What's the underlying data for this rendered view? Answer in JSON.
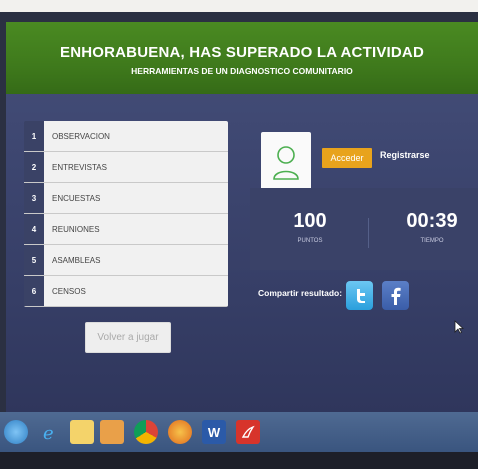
{
  "header": {
    "title": "ENHORABUENA, HAS SUPERADO LA ACTIVIDAD",
    "subtitle": "HERRAMIENTAS DE UN DIAGNOSTICO COMUNITARIO"
  },
  "activities": [
    {
      "num": "1",
      "label": "OBSERVACION"
    },
    {
      "num": "2",
      "label": "ENTREVISTAS"
    },
    {
      "num": "3",
      "label": "ENCUESTAS"
    },
    {
      "num": "4",
      "label": "REUNIONES"
    },
    {
      "num": "5",
      "label": "ASAMBLEAS"
    },
    {
      "num": "6",
      "label": "CENSOS"
    }
  ],
  "buttons": {
    "replay": "Volver a jugar",
    "login": "Acceder",
    "register": "Registrarse"
  },
  "stats": {
    "points_value": "100",
    "points_label": "PUNTOS",
    "time_value": "00:39",
    "time_label": "TIEMPO"
  },
  "share": {
    "label": "Compartir resultado:",
    "twitter_icon": "twitter-icon",
    "facebook_icon": "facebook-icon"
  },
  "colors": {
    "header_green": "#3f7a1c",
    "accent_orange": "#e8a31c",
    "panel_dark": "#3a4268"
  },
  "taskbar": {
    "icons": [
      "start-icon",
      "ie-icon",
      "folder-icon",
      "media-icon",
      "chrome-icon",
      "firefox-icon",
      "word-icon",
      "pdf-icon"
    ]
  }
}
